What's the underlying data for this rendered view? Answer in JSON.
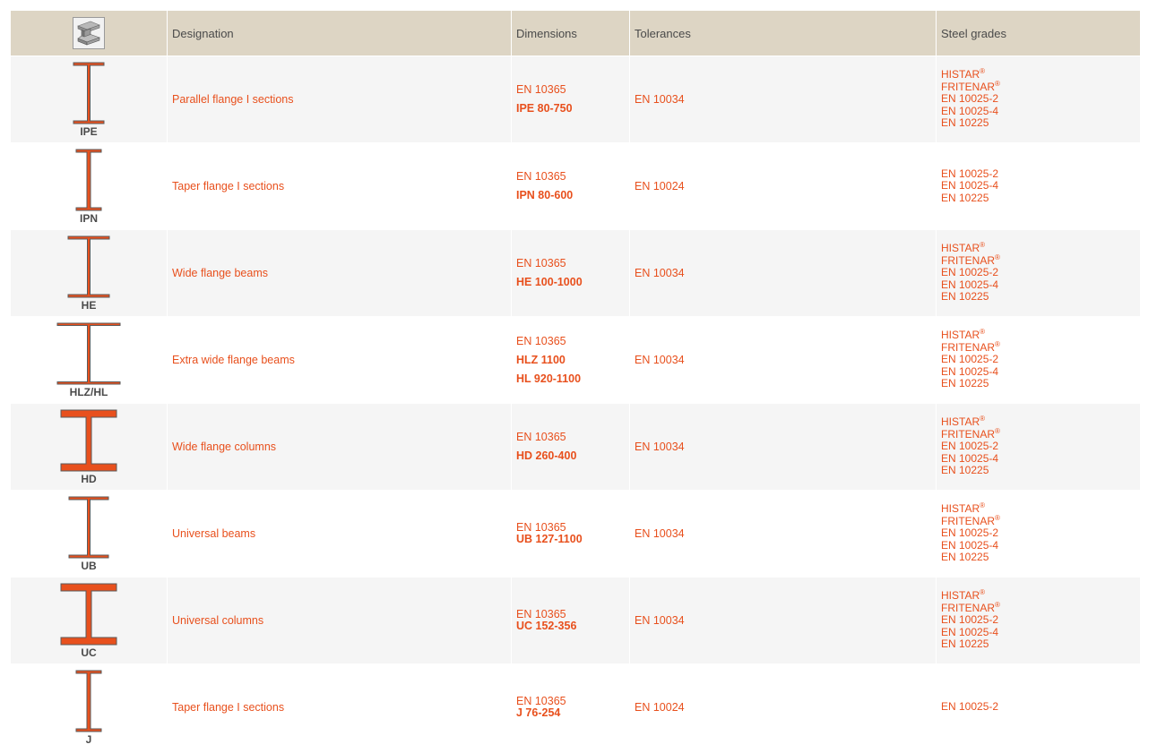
{
  "header": {
    "designation": "Designation",
    "dimensions": "Dimensions",
    "tolerances": "Tolerances",
    "steel_grades": "Steel grades"
  },
  "rows": [
    {
      "label": "IPE",
      "designation": "Parallel flange I sections",
      "dim_standard": "EN 10365",
      "dim_ranges": [
        "IPE 80-750"
      ],
      "dim_compact": false,
      "tolerance": "EN 10034",
      "grades": [
        {
          "text": "HISTAR",
          "sup": "®"
        },
        {
          "text": "FRITENAR",
          "sup": "®"
        },
        {
          "text": "EN 10025-2",
          "sup": ""
        },
        {
          "text": "EN 10025-4",
          "sup": ""
        },
        {
          "text": "EN 10225",
          "sup": ""
        }
      ]
    },
    {
      "label": "IPN",
      "designation": "Taper flange I sections",
      "dim_standard": "EN 10365",
      "dim_ranges": [
        "IPN 80-600"
      ],
      "dim_compact": false,
      "tolerance": "EN 10024",
      "grades": [
        {
          "text": "EN 10025-2",
          "sup": ""
        },
        {
          "text": "EN 10025-4",
          "sup": ""
        },
        {
          "text": "EN 10225",
          "sup": ""
        }
      ]
    },
    {
      "label": "HE",
      "designation": "Wide flange beams",
      "dim_standard": "EN 10365",
      "dim_ranges": [
        "HE 100-1000"
      ],
      "dim_compact": false,
      "tolerance": "EN 10034",
      "grades": [
        {
          "text": "HISTAR",
          "sup": "®"
        },
        {
          "text": "FRITENAR",
          "sup": "®"
        },
        {
          "text": "EN 10025-2",
          "sup": ""
        },
        {
          "text": "EN 10025-4",
          "sup": ""
        },
        {
          "text": "EN 10225",
          "sup": ""
        }
      ]
    },
    {
      "label": "HLZ/HL",
      "designation": "Extra wide flange beams",
      "dim_standard": "EN 10365",
      "dim_ranges": [
        "HLZ 1100",
        "HL 920-1100"
      ],
      "dim_compact": false,
      "tolerance": "EN 10034",
      "grades": [
        {
          "text": "HISTAR",
          "sup": "®"
        },
        {
          "text": "FRITENAR",
          "sup": "®"
        },
        {
          "text": "EN 10025-2",
          "sup": ""
        },
        {
          "text": "EN 10025-4",
          "sup": ""
        },
        {
          "text": "EN 10225",
          "sup": ""
        }
      ]
    },
    {
      "label": "HD",
      "designation": "Wide flange columns",
      "dim_standard": "EN 10365",
      "dim_ranges": [
        "HD 260-400"
      ],
      "dim_compact": false,
      "tolerance": "EN 10034",
      "grades": [
        {
          "text": "HISTAR",
          "sup": "®"
        },
        {
          "text": "FRITENAR",
          "sup": "®"
        },
        {
          "text": "EN 10025-2",
          "sup": ""
        },
        {
          "text": "EN 10025-4",
          "sup": ""
        },
        {
          "text": "EN 10225",
          "sup": ""
        }
      ]
    },
    {
      "label": "UB",
      "designation": "Universal beams",
      "dim_standard": "EN 10365",
      "dim_ranges": [
        "UB 127-1100"
      ],
      "dim_compact": true,
      "tolerance": "EN 10034",
      "grades": [
        {
          "text": "HISTAR",
          "sup": "®"
        },
        {
          "text": "FRITENAR",
          "sup": "®"
        },
        {
          "text": "EN 10025-2",
          "sup": ""
        },
        {
          "text": "EN 10025-4",
          "sup": ""
        },
        {
          "text": "EN 10225",
          "sup": ""
        }
      ]
    },
    {
      "label": "UC",
      "designation": "Universal columns",
      "dim_standard": "EN 10365",
      "dim_ranges": [
        "UC 152-356"
      ],
      "dim_compact": true,
      "tolerance": "EN 10034",
      "grades": [
        {
          "text": "HISTAR",
          "sup": "®"
        },
        {
          "text": "FRITENAR",
          "sup": "®"
        },
        {
          "text": "EN 10025-2",
          "sup": ""
        },
        {
          "text": "EN 10025-4",
          "sup": ""
        },
        {
          "text": "EN 10225",
          "sup": ""
        }
      ]
    },
    {
      "label": "J",
      "designation": "Taper flange I sections",
      "dim_standard": "EN 10365",
      "dim_ranges": [
        "J 76-254"
      ],
      "dim_compact": true,
      "tolerance": "EN 10024",
      "grades": [
        {
          "text": "EN 10025-2",
          "sup": ""
        }
      ]
    }
  ],
  "colors": {
    "accent": "#e8501d",
    "header_bg": "#ddd5c4",
    "row_alt": "#f5f5f5",
    "text_dark": "#4a4a4a",
    "beam_fill": "#e8501d",
    "beam_stroke": "#5a5a5a"
  }
}
